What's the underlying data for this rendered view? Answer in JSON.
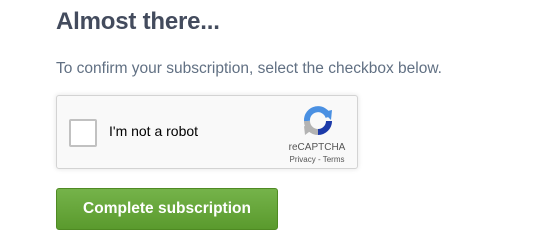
{
  "heading": "Almost there...",
  "description": "To confirm your subscription, select the checkbox below.",
  "recaptcha": {
    "checkbox_label": "I'm not a robot",
    "checked": false,
    "brand": "reCAPTCHA",
    "privacy_link": "Privacy",
    "separator": " - ",
    "terms_link": "Terms",
    "logo_icon": "recaptcha-logo",
    "colors": {
      "logo_blue": "#4a90e2",
      "logo_dark_blue": "#1c3aa9",
      "logo_gray": "#b3b3b3"
    }
  },
  "submit_button": {
    "label": "Complete subscription",
    "color": "#66a63a"
  },
  "colors": {
    "heading": "#434b5d",
    "description": "#617083"
  }
}
